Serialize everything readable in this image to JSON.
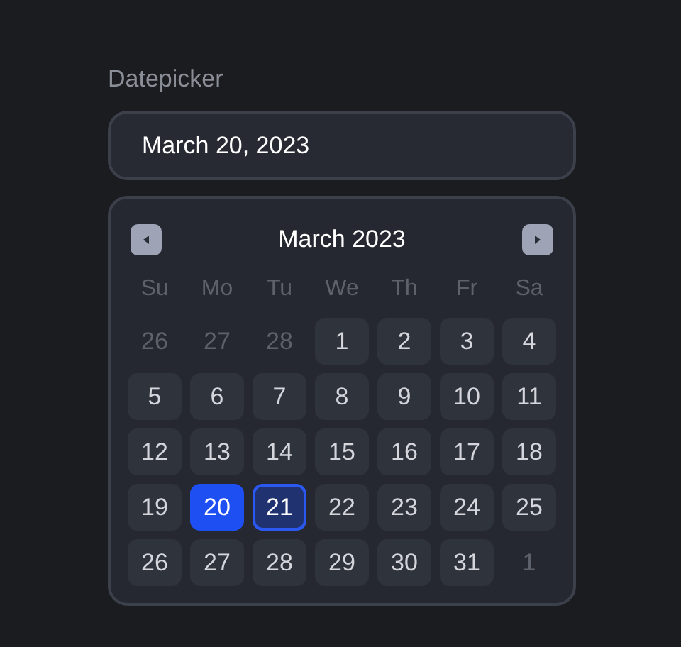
{
  "label": "Datepicker",
  "input": {
    "value": "March 20, 2023"
  },
  "calendar": {
    "month": "March 2023",
    "weekdays": [
      "Su",
      "Mo",
      "Tu",
      "We",
      "Th",
      "Fr",
      "Sa"
    ],
    "days": [
      {
        "text": "26",
        "outside": true,
        "selected": false,
        "focused": false
      },
      {
        "text": "27",
        "outside": true,
        "selected": false,
        "focused": false
      },
      {
        "text": "28",
        "outside": true,
        "selected": false,
        "focused": false
      },
      {
        "text": "1",
        "outside": false,
        "selected": false,
        "focused": false
      },
      {
        "text": "2",
        "outside": false,
        "selected": false,
        "focused": false
      },
      {
        "text": "3",
        "outside": false,
        "selected": false,
        "focused": false
      },
      {
        "text": "4",
        "outside": false,
        "selected": false,
        "focused": false
      },
      {
        "text": "5",
        "outside": false,
        "selected": false,
        "focused": false
      },
      {
        "text": "6",
        "outside": false,
        "selected": false,
        "focused": false
      },
      {
        "text": "7",
        "outside": false,
        "selected": false,
        "focused": false
      },
      {
        "text": "8",
        "outside": false,
        "selected": false,
        "focused": false
      },
      {
        "text": "9",
        "outside": false,
        "selected": false,
        "focused": false
      },
      {
        "text": "10",
        "outside": false,
        "selected": false,
        "focused": false
      },
      {
        "text": "11",
        "outside": false,
        "selected": false,
        "focused": false
      },
      {
        "text": "12",
        "outside": false,
        "selected": false,
        "focused": false
      },
      {
        "text": "13",
        "outside": false,
        "selected": false,
        "focused": false
      },
      {
        "text": "14",
        "outside": false,
        "selected": false,
        "focused": false
      },
      {
        "text": "15",
        "outside": false,
        "selected": false,
        "focused": false
      },
      {
        "text": "16",
        "outside": false,
        "selected": false,
        "focused": false
      },
      {
        "text": "17",
        "outside": false,
        "selected": false,
        "focused": false
      },
      {
        "text": "18",
        "outside": false,
        "selected": false,
        "focused": false
      },
      {
        "text": "19",
        "outside": false,
        "selected": false,
        "focused": false
      },
      {
        "text": "20",
        "outside": false,
        "selected": true,
        "focused": false
      },
      {
        "text": "21",
        "outside": false,
        "selected": false,
        "focused": true
      },
      {
        "text": "22",
        "outside": false,
        "selected": false,
        "focused": false
      },
      {
        "text": "23",
        "outside": false,
        "selected": false,
        "focused": false
      },
      {
        "text": "24",
        "outside": false,
        "selected": false,
        "focused": false
      },
      {
        "text": "25",
        "outside": false,
        "selected": false,
        "focused": false
      },
      {
        "text": "26",
        "outside": false,
        "selected": false,
        "focused": false
      },
      {
        "text": "27",
        "outside": false,
        "selected": false,
        "focused": false
      },
      {
        "text": "28",
        "outside": false,
        "selected": false,
        "focused": false
      },
      {
        "text": "29",
        "outside": false,
        "selected": false,
        "focused": false
      },
      {
        "text": "30",
        "outside": false,
        "selected": false,
        "focused": false
      },
      {
        "text": "31",
        "outside": false,
        "selected": false,
        "focused": false
      },
      {
        "text": "1",
        "outside": true,
        "selected": false,
        "focused": false
      }
    ]
  }
}
